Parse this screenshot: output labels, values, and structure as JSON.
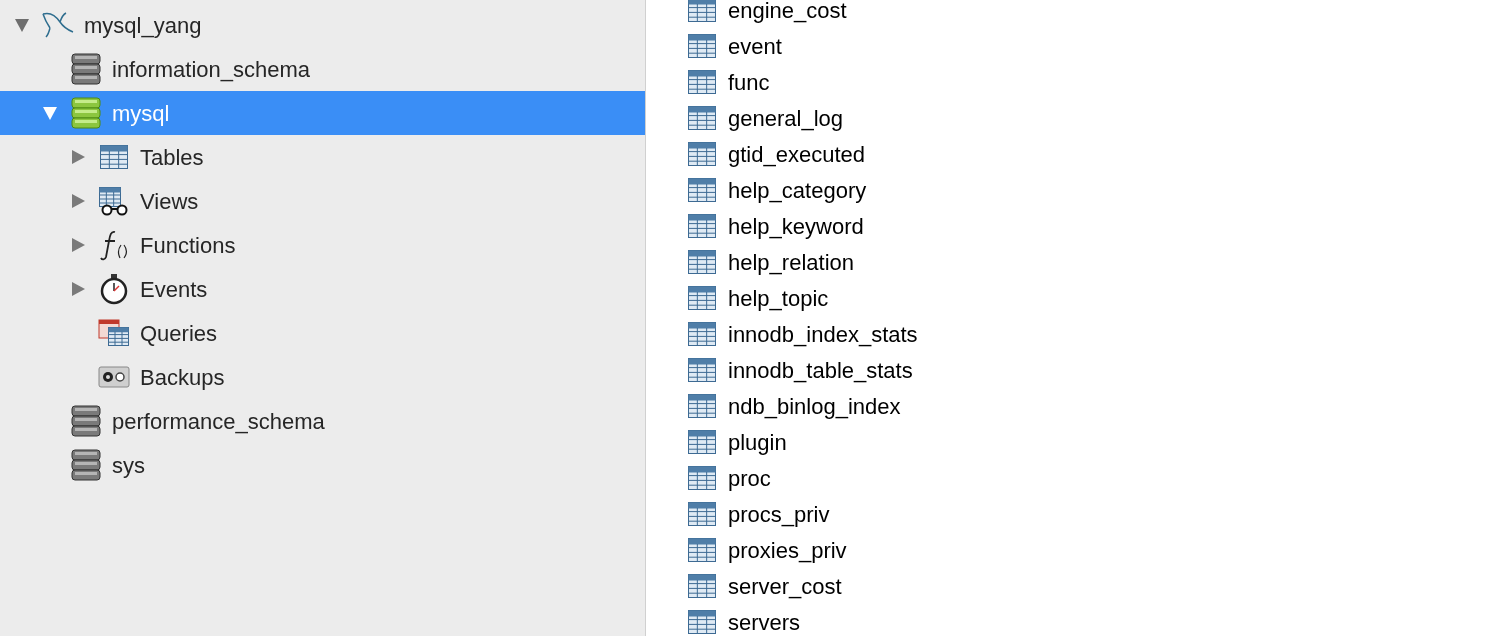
{
  "sidebar": {
    "tree": [
      {
        "label": "mysql_yang",
        "kind": "server",
        "expanded": true,
        "selected": false,
        "children": [
          {
            "label": "information_schema",
            "kind": "database",
            "selected": false
          },
          {
            "label": "mysql",
            "kind": "database",
            "expanded": true,
            "selected": true,
            "children": [
              {
                "label": "Tables",
                "kind": "tables",
                "expanded": false,
                "selected": false
              },
              {
                "label": "Views",
                "kind": "views",
                "expanded": false,
                "selected": false
              },
              {
                "label": "Functions",
                "kind": "functions",
                "expanded": false,
                "selected": false
              },
              {
                "label": "Events",
                "kind": "events",
                "expanded": false,
                "selected": false
              },
              {
                "label": "Queries",
                "kind": "queries",
                "selected": false
              },
              {
                "label": "Backups",
                "kind": "backups",
                "selected": false
              }
            ]
          },
          {
            "label": "performance_schema",
            "kind": "database",
            "selected": false
          },
          {
            "label": "sys",
            "kind": "database",
            "selected": false
          }
        ]
      }
    ]
  },
  "tables": [
    "engine_cost",
    "event",
    "func",
    "general_log",
    "gtid_executed",
    "help_category",
    "help_keyword",
    "help_relation",
    "help_topic",
    "innodb_index_stats",
    "innodb_table_stats",
    "ndb_binlog_index",
    "plugin",
    "proc",
    "procs_priv",
    "proxies_priv",
    "server_cost",
    "servers"
  ]
}
